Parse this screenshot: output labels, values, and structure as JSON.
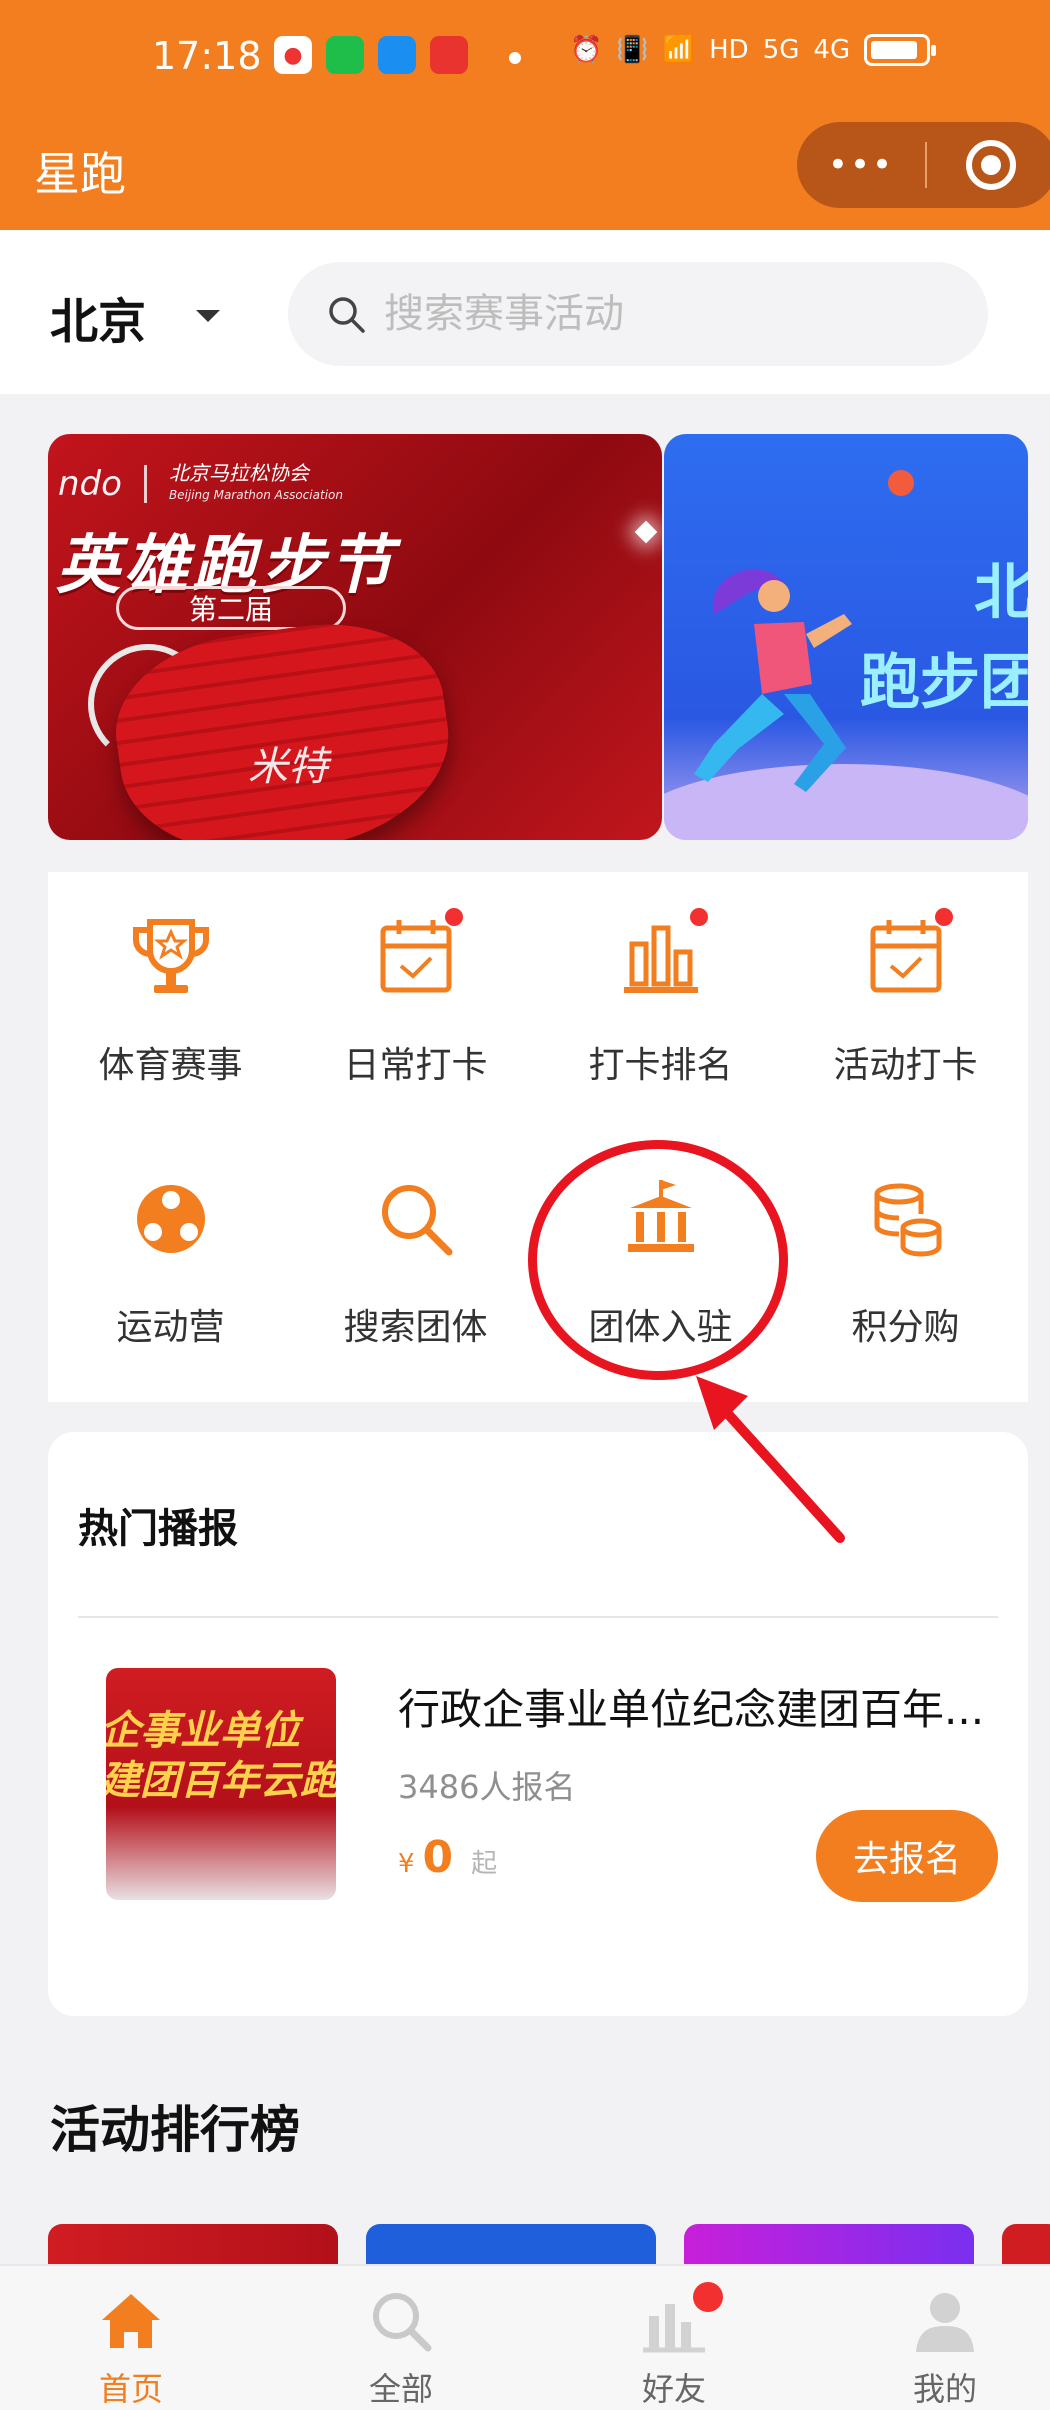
{
  "status_bar": {
    "time": "17:18",
    "signal_labels": [
      "HD",
      "5G",
      "4G"
    ]
  },
  "navbar": {
    "title": "星跑",
    "more_label": "•••"
  },
  "search": {
    "city": "北京",
    "placeholder": "搜索赛事活动"
  },
  "banner": [
    {
      "brand": "ndo",
      "association": "北京马拉松协会",
      "association_en": "Beijing Marathon Association",
      "title": "英雄跑步节",
      "edition": "第二届",
      "signature": "米特"
    },
    {
      "title_line1": "北",
      "title_line2": "跑步团"
    }
  ],
  "grid": [
    {
      "label": "体育赛事",
      "icon": "trophy-icon",
      "dot": false
    },
    {
      "label": "日常打卡",
      "icon": "calendar-check-icon",
      "dot": true
    },
    {
      "label": "打卡排名",
      "icon": "bar-chart-icon",
      "dot": true
    },
    {
      "label": "活动打卡",
      "icon": "calendar-check-icon",
      "dot": true
    },
    {
      "label": "运动营",
      "icon": "group-icon",
      "dot": false
    },
    {
      "label": "搜索团体",
      "icon": "search-icon",
      "dot": false
    },
    {
      "label": "团体入驻",
      "icon": "building-flag-icon",
      "dot": false
    },
    {
      "label": "积分购",
      "icon": "coins-icon",
      "dot": false
    }
  ],
  "hot": {
    "title": "热门播报",
    "event": {
      "thumb_line1": "企事业单位",
      "thumb_line2": "建团百年云跑",
      "title": "行政企事业单位纪念建团百年...",
      "count": "3486人报名",
      "currency": "¥",
      "price": "0",
      "price_suffix": "起",
      "button": "去报名"
    }
  },
  "ranking": {
    "title": "活动排行榜"
  },
  "tabbar": [
    {
      "label": "首页",
      "icon": "home-icon",
      "active": true
    },
    {
      "label": "全部",
      "icon": "search-icon",
      "active": false
    },
    {
      "label": "好友",
      "icon": "bar-chart-icon",
      "active": false
    },
    {
      "label": "我的",
      "icon": "user-icon",
      "active": false
    }
  ],
  "colors": {
    "brand": "#f27e1f",
    "annotation": "#e8141f",
    "badge": "#f23030"
  }
}
